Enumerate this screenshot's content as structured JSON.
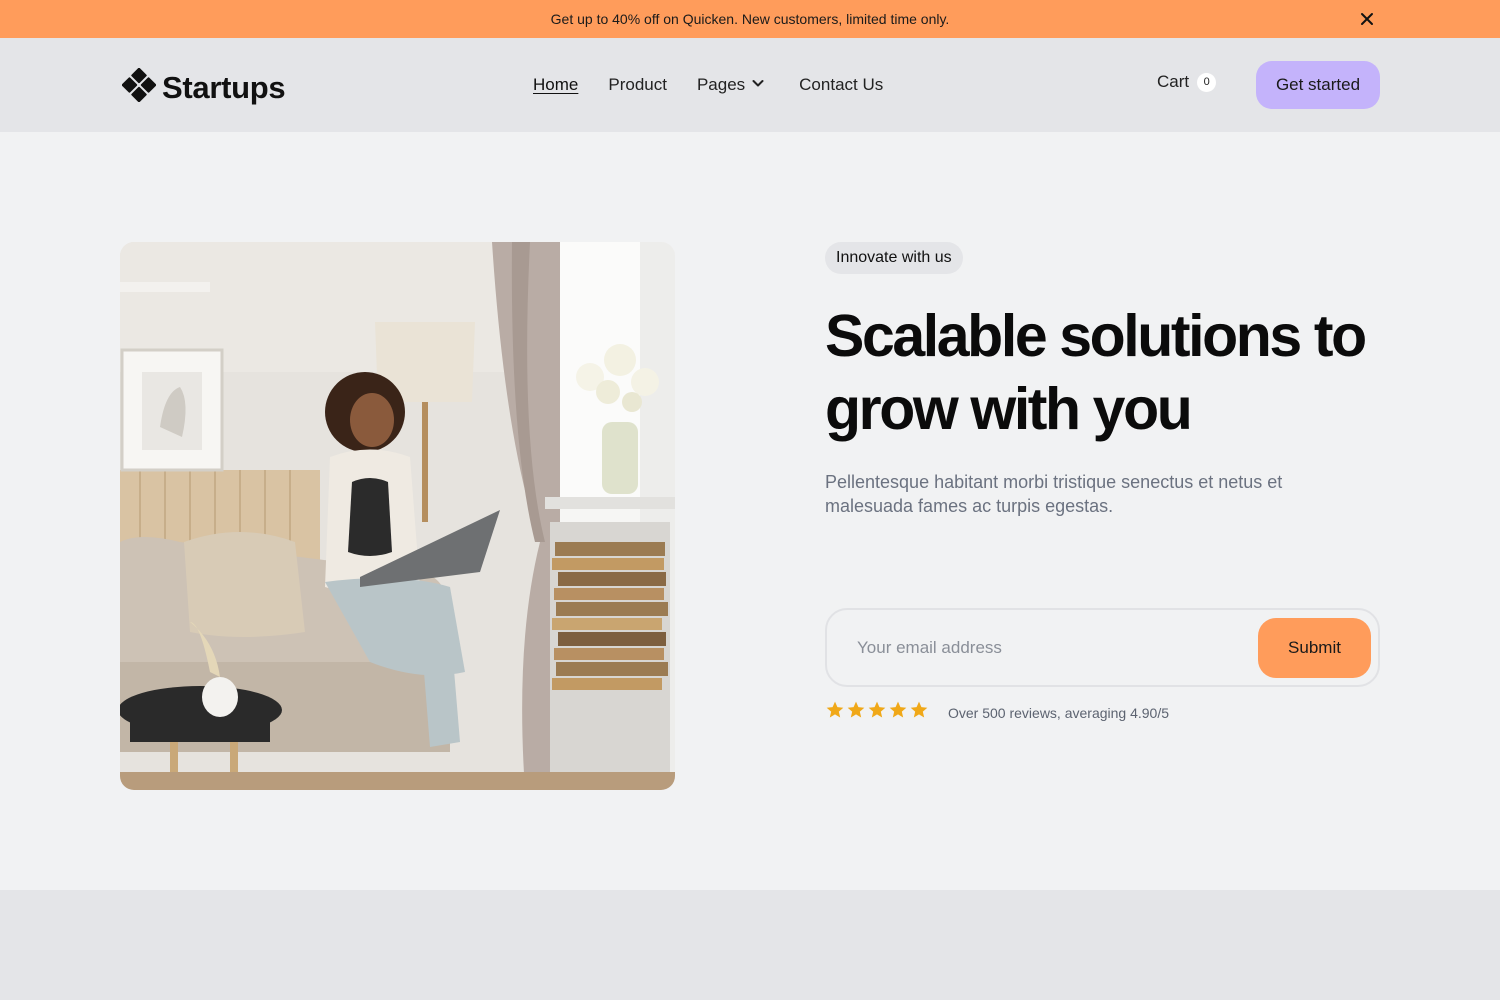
{
  "announcement": {
    "text": "Get up to 40% off on Quicken. New customers, limited time only.",
    "close_icon": "close-icon"
  },
  "nav": {
    "brand": "Startups",
    "logo_icon": "diamond-grid-icon",
    "items": [
      {
        "label": "Home",
        "active": true
      },
      {
        "label": "Product"
      },
      {
        "label": "Pages",
        "has_dropdown": true
      },
      {
        "label": "Contact Us"
      }
    ],
    "cart": {
      "label": "Cart",
      "count": "0"
    },
    "cta_label": "Get started"
  },
  "hero": {
    "image_alt": "Woman sitting on a sofa with a laptop by a window",
    "tagline": "Innovate with us",
    "headline": "Scalable solutions to grow with you",
    "subtext": "Pellentesque habitant morbi tristique senectus et netus et malesuada fames ac turpis egestas.",
    "form": {
      "email_placeholder": "Your email address",
      "submit_label": "Submit"
    },
    "rating": {
      "stars": 5,
      "text": "Over 500 reviews, averaging 4.90/5"
    }
  },
  "colors": {
    "banner": "#ff9c5b",
    "cta": "#c4b3fb",
    "submit": "#ff9c5b",
    "star": "#f0a818",
    "hero_bg": "#f1f2f3",
    "nav_bg": "#e4e5e8"
  }
}
